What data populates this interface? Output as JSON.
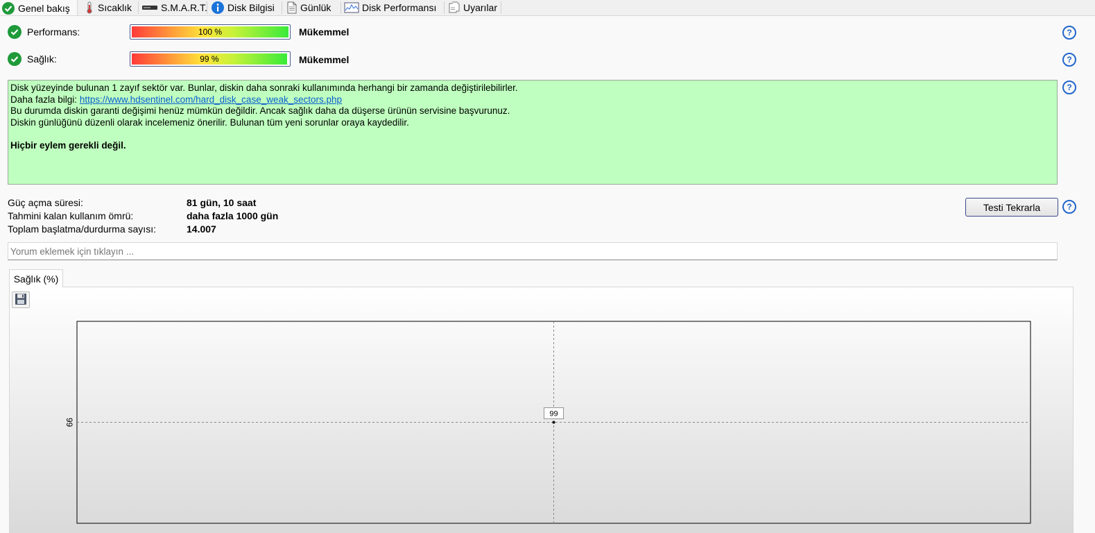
{
  "tabs": [
    {
      "label": "Genel bakış",
      "icon": "check-circle-icon"
    },
    {
      "label": "Sıcaklık",
      "icon": "thermometer-icon"
    },
    {
      "label": "S.M.A.R.T.",
      "icon": "disk-bar-icon"
    },
    {
      "label": "Disk Bilgisi",
      "icon": "info-icon"
    },
    {
      "label": "Günlük",
      "icon": "document-icon"
    },
    {
      "label": "Disk Performansı",
      "icon": "performance-chart-icon"
    },
    {
      "label": "Uyarılar",
      "icon": "alerts-icon"
    }
  ],
  "performance": {
    "label": "Performans:",
    "value_text": "100 %",
    "value": 100,
    "verdict": "Mükemmel"
  },
  "health": {
    "label": "Sağlık:",
    "value_text": "99 %",
    "value": 99,
    "verdict": "Mükemmel"
  },
  "help_glyph": "?",
  "info": {
    "line1": "Disk yüzeyinde bulunan 1 zayıf sektör var. Bunlar, diskin daha sonraki kullanımında herhangi bir zamanda değiştirilebilirler.",
    "more_prefix": "Daha fazla bilgi: ",
    "more_link": "https://www.hdsentinel.com/hard_disk_case_weak_sectors.php",
    "line3": "Bu durumda diskin garanti değişimi henüz mümkün değildir. Ancak sağlık daha da düşerse ürünün servisine başvurunuz.",
    "line4": "Diskin günlüğünü düzenli olarak incelemeniz önerilir. Bulunan tüm yeni sorunlar oraya kaydedilir.",
    "action": "Hiçbir eylem gerekli değil."
  },
  "stats": [
    {
      "label": "Güç açma süresi:",
      "value": "81 gün, 10 saat"
    },
    {
      "label": "Tahmini kalan kullanım ömrü:",
      "value": "daha fazla 1000 gün"
    },
    {
      "label": "Toplam başlatma/durdurma sayısı:",
      "value": "14.007"
    }
  ],
  "retest_label": "Testi Tekrarla",
  "comment_placeholder": "Yorum eklemek için tıklayın ...",
  "chart_tab_label": "Sağlık (%)",
  "colors": {
    "ok_green": "#1f9a3a",
    "info_bg": "#bfffbf",
    "link": "#0a5fd0",
    "help_blue": "#2266cc"
  },
  "chart_data": {
    "type": "line",
    "title": "",
    "xlabel": "",
    "ylabel": "",
    "y_tick_labels": [
      "99"
    ],
    "series": [
      {
        "values": [
          99
        ],
        "point_labels": [
          "99"
        ]
      }
    ],
    "grid": true,
    "legend": "none"
  }
}
